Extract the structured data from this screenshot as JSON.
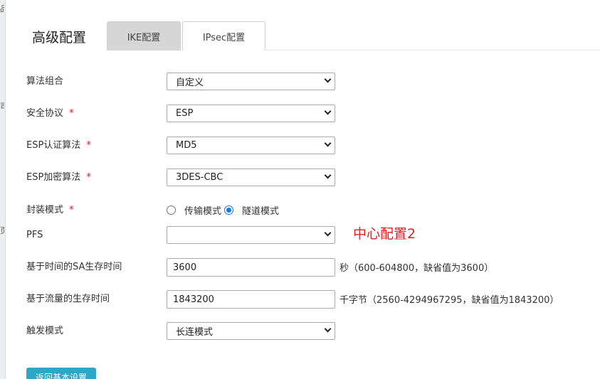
{
  "edge_glyphs": [
    "品",
    "司",
    "页"
  ],
  "page_title": "高级配置",
  "tabs": [
    {
      "label": "IKE配置",
      "active": true
    },
    {
      "label": "IPsec配置",
      "active": false
    }
  ],
  "form": {
    "required_mark": "*",
    "algorithm_combo": {
      "label": "算法组合",
      "value": "自定义"
    },
    "security_protocol": {
      "label": "安全协议",
      "value": "ESP"
    },
    "esp_auth_algorithm": {
      "label": "ESP认证算法",
      "value": "MD5"
    },
    "esp_encrypt_algorithm": {
      "label": "ESP加密算法",
      "value": "3DES-CBC"
    },
    "encapsulation_mode": {
      "label": "封装模式",
      "options": [
        {
          "label": "传输模式",
          "checked": false
        },
        {
          "label": "隧道模式",
          "checked": true
        }
      ]
    },
    "pfs": {
      "label": "PFS",
      "value": ""
    },
    "sa_lifetime_time": {
      "label": "基于时间的SA生存时间",
      "value": "3600",
      "hint": "秒（600-604800，缺省值为3600）"
    },
    "sa_lifetime_traffic": {
      "label": "基于流量的生存时间",
      "value": "1843200",
      "hint": "千字节（2560-4294967295，缺省值为1843200）"
    },
    "trigger_mode": {
      "label": "触发模式",
      "value": "长连模式"
    }
  },
  "annotation": "中心配置2",
  "back_button": "返回基本设置",
  "colors": {
    "required": "#e02020",
    "annotation": "#e02020",
    "button": "#2fa6c5",
    "radio_checked": "#1a73e8"
  }
}
